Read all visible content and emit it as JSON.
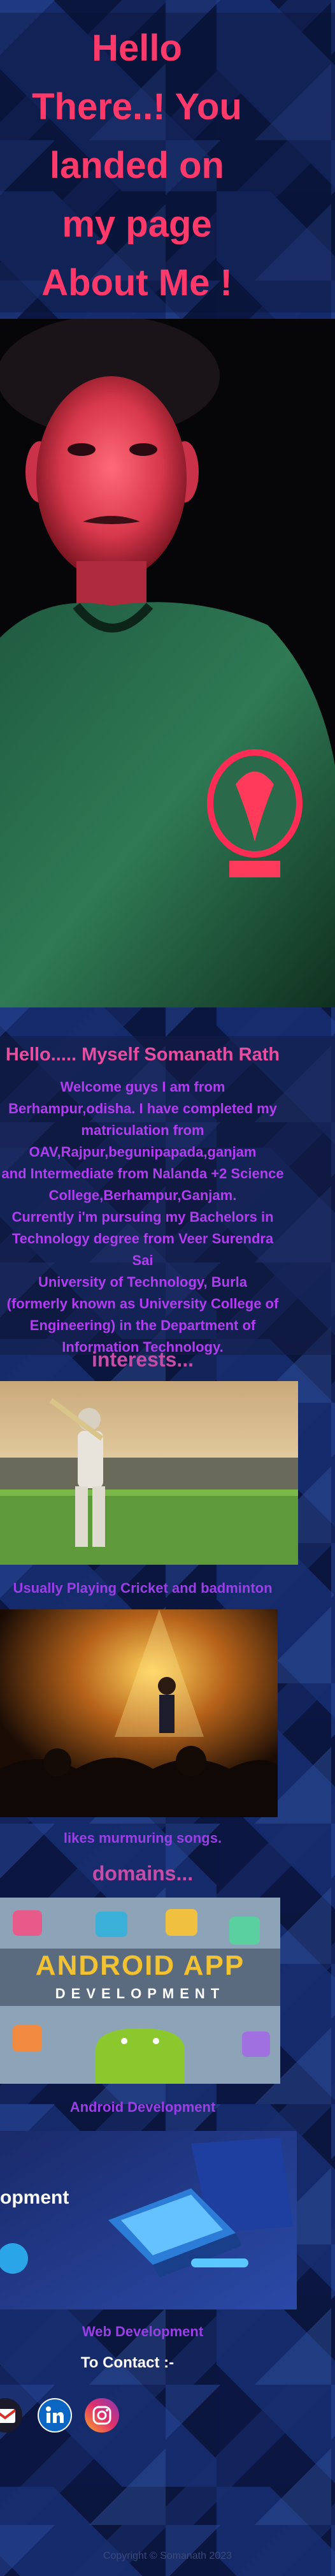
{
  "hero": {
    "title_lines": [
      "Hello",
      "There..! You",
      "landed on",
      "my page",
      "About Me !"
    ]
  },
  "about": {
    "heading": "Hello..... Myself Somanath Rath",
    "lines": [
      "Welcome guys I am from",
      "Berhampur,odisha. I have completed my",
      "matriculation from",
      "OAV,Rajpur,begunipapada,ganjam",
      "and Intermediate from Nalanda +2 Science",
      "College,Berhampur,Ganjam.",
      "Currently i'm pursuing my Bachelors in",
      "Technology degree from Veer Surendra Sai",
      "University of Technology, Burla",
      "(formerly known as University College of",
      "Engineering) in the Department of",
      "Information Technology."
    ]
  },
  "interests": {
    "heading": "interests...",
    "items": [
      {
        "caption": "Usually Playing Cricket and badminton"
      },
      {
        "caption": "likes murmuring songs."
      }
    ]
  },
  "domains": {
    "heading": "domains...",
    "items": [
      {
        "caption": "Android Development",
        "banner_title": "ANDROID APP",
        "banner_sub": "DEVELOPMENT"
      },
      {
        "caption": "Web Development",
        "banner_title": "opment"
      }
    ]
  },
  "contact": {
    "heading": "To Contact :-",
    "links": [
      {
        "icon": "gmail-icon",
        "color": "#d93025"
      },
      {
        "icon": "linkedin-icon",
        "color": "#0a66c2"
      },
      {
        "icon": "instagram-icon",
        "color": "#e1306c"
      }
    ]
  },
  "footer": {
    "text": "Copyright © Somanath 2023"
  },
  "colors": {
    "title": "#ff3a6a",
    "heading": "#ea4da0",
    "body_text": "#b23df0",
    "background": "#0d1f52"
  }
}
